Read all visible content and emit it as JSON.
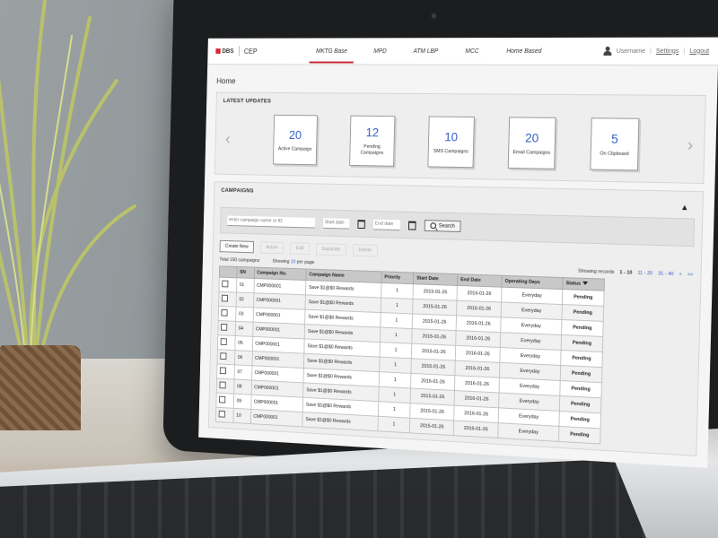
{
  "header": {
    "brand": "DBS",
    "app": "CEP",
    "nav": [
      {
        "label": "MKTG Base",
        "active": true
      },
      {
        "label": "MPD",
        "active": false
      },
      {
        "label": "ATM LBP",
        "active": false
      },
      {
        "label": "MCC",
        "active": false
      },
      {
        "label": "Home Based",
        "active": false
      }
    ],
    "user": {
      "name": "Username",
      "settings": "Settings",
      "logout": "Logout"
    },
    "accent_color": "#c9252b"
  },
  "page": {
    "title": "Home"
  },
  "updates": {
    "heading": "LATEST UPDATES",
    "tiles": [
      {
        "count": "20",
        "label": "Active Campaign"
      },
      {
        "count": "12",
        "label": "Pending Campaigns"
      },
      {
        "count": "10",
        "label": "SMS Campaigns"
      },
      {
        "count": "20",
        "label": "Email Campaigns"
      },
      {
        "count": "5",
        "label": "On Clipboard"
      }
    ],
    "prev_icon": "chevron-left-icon",
    "next_icon": "chevron-right-icon"
  },
  "campaigns": {
    "heading": "CAMPAIGNS",
    "filter": {
      "name_placeholder": "enter campaign name or ID",
      "start_placeholder": "Start date",
      "end_placeholder": "End date",
      "search_label": "Search"
    },
    "actions": [
      "Create New",
      "Active",
      "Edit",
      "Duplicate",
      "Delete"
    ],
    "total": "Total 150 campaigns",
    "showing_prefix": "Showing",
    "per_page_value": "10",
    "per_page_suffix": "per page",
    "pager": {
      "showing_label": "Showing records",
      "current": "1 - 10",
      "pages": [
        "11 - 20",
        "31 - 40"
      ],
      "next": ">",
      "last": ">>"
    },
    "columns": [
      "SN",
      "Campaign No.",
      "Campaign Name",
      "Priority",
      "Start Date",
      "End Date",
      "Operating Days",
      "Status"
    ],
    "rows": [
      {
        "sn": "01",
        "no": "CMP000001",
        "name": "Save $1@$0 Rewards",
        "priority": "1",
        "start": "2015-01-26",
        "end": "2016-01-26",
        "days": "Everyday",
        "status": "Pending"
      },
      {
        "sn": "02",
        "no": "CMP000001",
        "name": "Save $1@$0 Rewards",
        "priority": "1",
        "start": "2015-01-26",
        "end": "2016-01-26",
        "days": "Everyday",
        "status": "Pending"
      },
      {
        "sn": "03",
        "no": "CMP000001",
        "name": "Save $1@$0 Rewards",
        "priority": "1",
        "start": "2015-01-26",
        "end": "2016-01-26",
        "days": "Everyday",
        "status": "Pending"
      },
      {
        "sn": "04",
        "no": "CMP000001",
        "name": "Save $1@$0 Rewards",
        "priority": "1",
        "start": "2015-01-26",
        "end": "2016-01-26",
        "days": "Everyday",
        "status": "Pending"
      },
      {
        "sn": "05",
        "no": "CMP000001",
        "name": "Save $1@$0 Rewards",
        "priority": "1",
        "start": "2015-01-26",
        "end": "2016-01-26",
        "days": "Everyday",
        "status": "Pending"
      },
      {
        "sn": "06",
        "no": "CMP000001",
        "name": "Save $1@$0 Rewards",
        "priority": "1",
        "start": "2015-01-26",
        "end": "2016-01-26",
        "days": "Everyday",
        "status": "Pending"
      },
      {
        "sn": "07",
        "no": "CMP000001",
        "name": "Save $1@$0 Rewards",
        "priority": "1",
        "start": "2015-01-26",
        "end": "2016-01-26",
        "days": "Everyday",
        "status": "Pending"
      },
      {
        "sn": "08",
        "no": "CMP000001",
        "name": "Save $1@$0 Rewards",
        "priority": "1",
        "start": "2015-01-26",
        "end": "2016-01-26",
        "days": "Everyday",
        "status": "Pending"
      },
      {
        "sn": "09",
        "no": "CMP000001",
        "name": "Save $1@$0 Rewards",
        "priority": "1",
        "start": "2015-01-26",
        "end": "2016-01-26",
        "days": "Everyday",
        "status": "Pending"
      },
      {
        "sn": "10",
        "no": "CMP000001",
        "name": "Save $1@$0 Rewards",
        "priority": "1",
        "start": "2015-01-26",
        "end": "2016-01-26",
        "days": "Everyday",
        "status": "Pending"
      }
    ]
  }
}
